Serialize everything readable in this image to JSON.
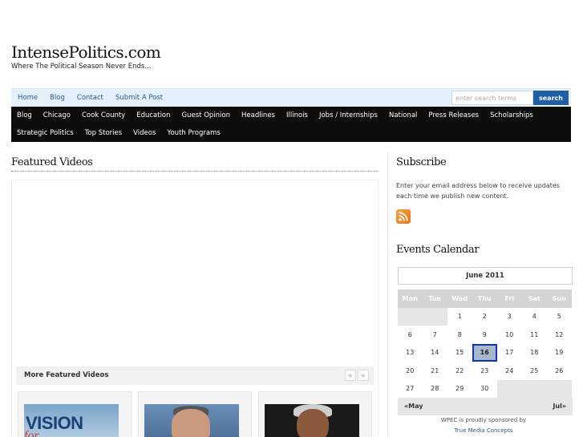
{
  "site": {
    "title": "IntensePolitics.com",
    "tagline": "Where The Political Season Never Ends..."
  },
  "topnav": {
    "links": [
      "Home",
      "Blog",
      "Contact",
      "Submit A Post"
    ],
    "search_placeholder": "enter search terms",
    "search_button": "search"
  },
  "categories": {
    "row1": [
      "Blog",
      "Chicago",
      "Cook County",
      "Education",
      "Guest Opinion",
      "Headlines",
      "Illinois",
      "Jobs / Internships",
      "National",
      "Press Releases",
      "Scholarships"
    ],
    "row2": [
      "Strategic Politics",
      "Top Stories",
      "Videos",
      "Youth Programs"
    ]
  },
  "featured": {
    "title": "Featured Videos",
    "more_label": "More Featured Videos",
    "prev_label": "«",
    "next_label": "»",
    "thumb1_text": "VISION",
    "thumb1_subtext": "for"
  },
  "subscribe": {
    "title": "Subscribe",
    "text": "Enter your email address below to receive updates each time we publish new content.",
    "icon": "rss-icon"
  },
  "events": {
    "title": "Events Calendar",
    "month_label": "June  2011",
    "weekdays": [
      "Mon",
      "Tue",
      "Wed",
      "Thu",
      "Fri",
      "Sat",
      "Sun"
    ],
    "days": [
      "",
      "",
      "1",
      "2",
      "3",
      "4",
      "5",
      "6",
      "7",
      "8",
      "9",
      "10",
      "11",
      "12",
      "13",
      "14",
      "15",
      "16",
      "17",
      "18",
      "19",
      "20",
      "21",
      "22",
      "23",
      "24",
      "25",
      "26",
      "27",
      "28",
      "29",
      "30",
      "",
      "",
      ""
    ],
    "today": "16",
    "prev_month": "«May",
    "next_month": "Jul»"
  },
  "sponsor": {
    "line": "WPEC is proudly sponsored by",
    "link": "True Media Concepts"
  },
  "colors": {
    "nav_bg": "#e4f1fb",
    "category_bg": "#0d0d0d",
    "search_button": "#1f5fa8",
    "today_border": "#1030c8",
    "link": "#2a5a8c"
  }
}
